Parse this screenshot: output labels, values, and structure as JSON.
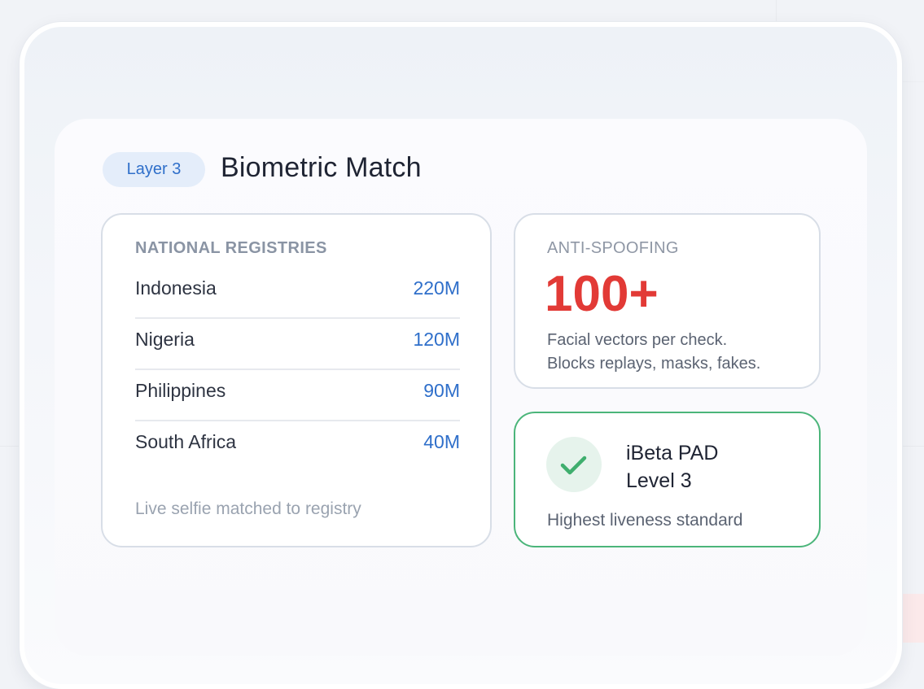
{
  "layer": {
    "badge": "Layer 3",
    "title": "Biometric Match"
  },
  "registries": {
    "heading": "NATIONAL REGISTRIES",
    "rows": [
      {
        "country": "Indonesia",
        "count": "220M"
      },
      {
        "country": "Nigeria",
        "count": "120M"
      },
      {
        "country": "Philippines",
        "count": "90M"
      },
      {
        "country": "South Africa",
        "count": "40M"
      }
    ],
    "footnote": "Live selfie matched to registry"
  },
  "anti_spoofing": {
    "label": "ANTI-SPOOFING",
    "value": "100+",
    "desc_line1": "Facial vectors per check.",
    "desc_line2": "Blocks replays, masks, fakes."
  },
  "ibeta": {
    "icon": "check-icon",
    "title_line1": "iBeta PAD",
    "title_line2": "Level 3",
    "subtitle": "Highest liveness standard"
  },
  "colors": {
    "accent_blue": "#2f6fca",
    "accent_red": "#e23a36",
    "accent_green": "#4bb57a"
  }
}
